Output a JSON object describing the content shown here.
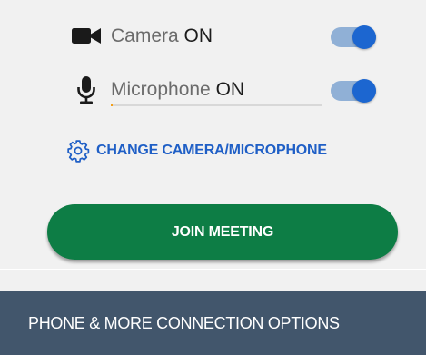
{
  "camera": {
    "icon": "video-camera-icon",
    "name": "Camera",
    "state": "ON",
    "toggle_on": true
  },
  "microphone": {
    "icon": "microphone-icon",
    "name": "Microphone",
    "state": "ON",
    "toggle_on": true,
    "input_level": 0.01
  },
  "change_devices": {
    "icon": "gear-icon",
    "label": "CHANGE CAMERA/MICROPHONE"
  },
  "join_button": {
    "label": "JOIN MEETING"
  },
  "options_bar": {
    "label": "PHONE & MORE CONNECTION OPTIONS"
  },
  "colors": {
    "background": "#f1f1f1",
    "toggle_knob": "#1c66d0",
    "toggle_track": "#90b0d6",
    "link": "#1f5fc6",
    "join_button": "#0d7d45",
    "options_bar": "#42566c",
    "mic_level": "#f3a01a"
  }
}
